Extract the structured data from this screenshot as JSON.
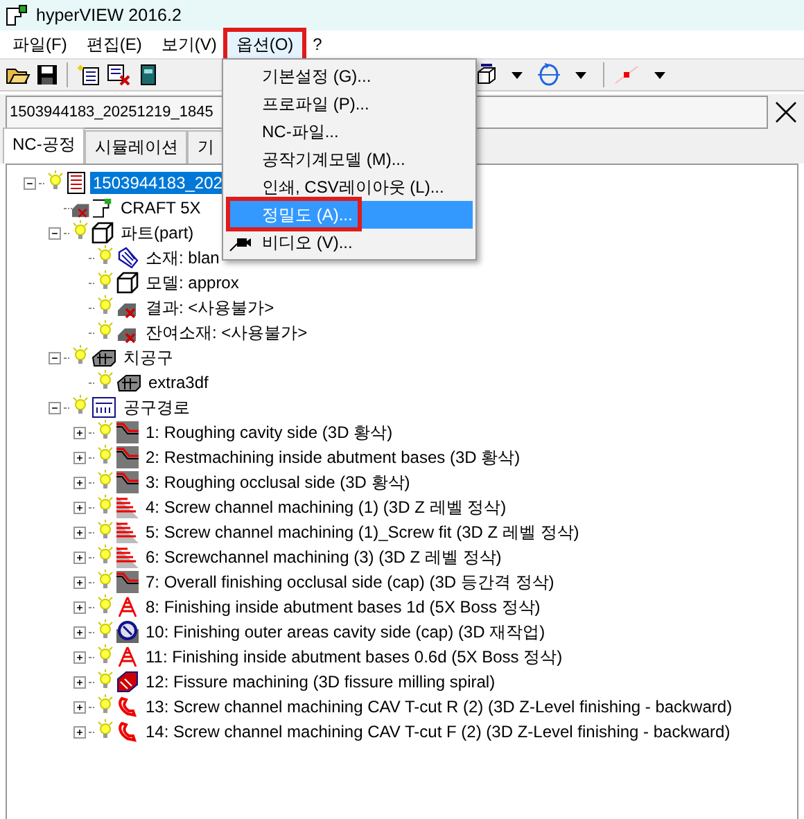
{
  "window": {
    "title": "hyperVIEW 2016.2"
  },
  "menubar": [
    {
      "label": "파일(F)",
      "selected": false
    },
    {
      "label": "편집(E)",
      "selected": false
    },
    {
      "label": "보기(V)",
      "selected": false
    },
    {
      "label": "옵션(O)",
      "selected": true
    },
    {
      "label": "?",
      "selected": false
    }
  ],
  "path_field": {
    "value": "1503944183_20251219_1845"
  },
  "tabs": [
    {
      "label": "NC-공정",
      "selected": true
    },
    {
      "label": "시뮬레이션",
      "selected": false
    },
    {
      "label": "기",
      "selected": false
    }
  ],
  "tree": [
    {
      "label": "1503944183_202",
      "kind": "document",
      "visible": true,
      "expanded": true,
      "selected": true,
      "children": [
        {
          "label": "CRAFT 5X",
          "kind": "machine",
          "visible": false,
          "selected": false
        },
        {
          "label": "파트(part)",
          "kind": "cube",
          "visible": true,
          "expanded": true,
          "selected": false,
          "children": [
            {
              "label": "소재: blan",
              "kind": "blank",
              "visible": true,
              "selected": false
            },
            {
              "label": "모델: approx",
              "kind": "cube",
              "visible": true,
              "selected": false
            },
            {
              "label": "결과: <사용불가>",
              "kind": "unavailable",
              "visible": true,
              "selected": false
            },
            {
              "label": "잔여소재: <사용불가>",
              "kind": "unavailable",
              "visible": true,
              "selected": false
            }
          ]
        },
        {
          "label": "치공구",
          "kind": "fixture",
          "visible": true,
          "expanded": true,
          "selected": false,
          "children": [
            {
              "label": "extra3df",
              "kind": "fixture",
              "visible": true,
              "selected": false
            }
          ]
        },
        {
          "label": "공구경로",
          "kind": "toolpaths",
          "visible": true,
          "expanded": true,
          "selected": false,
          "children": [
            {
              "label": "1: Roughing cavity side (3D 황삭)",
              "kind": "roughing",
              "visible": true,
              "expanded": false,
              "selected": false
            },
            {
              "label": "2: Restmachining inside abutment bases (3D 황삭)",
              "kind": "roughing",
              "visible": true,
              "expanded": false,
              "selected": false
            },
            {
              "label": "3: Roughing occlusal side (3D 황삭)",
              "kind": "roughing",
              "visible": true,
              "expanded": false,
              "selected": false
            },
            {
              "label": "4: Screw channel machining (1) (3D Z 레벨 정삭)",
              "kind": "zlevel",
              "visible": true,
              "expanded": false,
              "selected": false
            },
            {
              "label": "5: Screw channel machining (1)_Screw fit (3D Z 레벨 정삭)",
              "kind": "zlevel",
              "visible": true,
              "expanded": false,
              "selected": false
            },
            {
              "label": "6: Screwchannel machining (3) (3D Z 레벨 정삭)",
              "kind": "zlevel",
              "visible": true,
              "expanded": false,
              "selected": false
            },
            {
              "label": "7: Overall finishing occlusal side (cap) (3D 등간격 정삭)",
              "kind": "roughing",
              "visible": true,
              "expanded": false,
              "selected": false
            },
            {
              "label": "8: Finishing inside abutment bases 1d (5X Boss 정삭)",
              "kind": "boss",
              "visible": true,
              "expanded": false,
              "selected": false
            },
            {
              "label": "10: Finishing outer areas cavity side (cap) (3D 재작업)",
              "kind": "rework",
              "visible": true,
              "expanded": false,
              "selected": false
            },
            {
              "label": "11: Finishing inside abutment bases 0.6d (5X Boss 정삭)",
              "kind": "boss",
              "visible": true,
              "expanded": false,
              "selected": false
            },
            {
              "label": "12: Fissure machining (3D fissure milling spiral)",
              "kind": "fissure",
              "visible": true,
              "expanded": false,
              "selected": false
            },
            {
              "label": "13: Screw channel machining CAV T-cut R (2) (3D Z-Level finishing - backward)",
              "kind": "tcut",
              "visible": true,
              "expanded": false,
              "selected": false
            },
            {
              "label": "14: Screw channel machining CAV T-cut F (2) (3D Z-Level finishing - backward)",
              "kind": "tcut",
              "visible": true,
              "expanded": false,
              "selected": false
            }
          ]
        }
      ]
    }
  ],
  "dropdown_menu": [
    {
      "label": "기본설정 (G)...",
      "selected": false
    },
    {
      "label": "프로파일 (P)...",
      "selected": false
    },
    {
      "label": "NC-파일...",
      "selected": false
    },
    {
      "label": "공작기계모델 (M)...",
      "selected": false
    },
    {
      "label": "인쇄, CSV레이아웃 (L)...",
      "selected": false
    },
    {
      "label": "정밀도 (A)...",
      "selected": true
    },
    {
      "label": "비디오 (V)...",
      "selected": false,
      "kind": "video"
    }
  ]
}
